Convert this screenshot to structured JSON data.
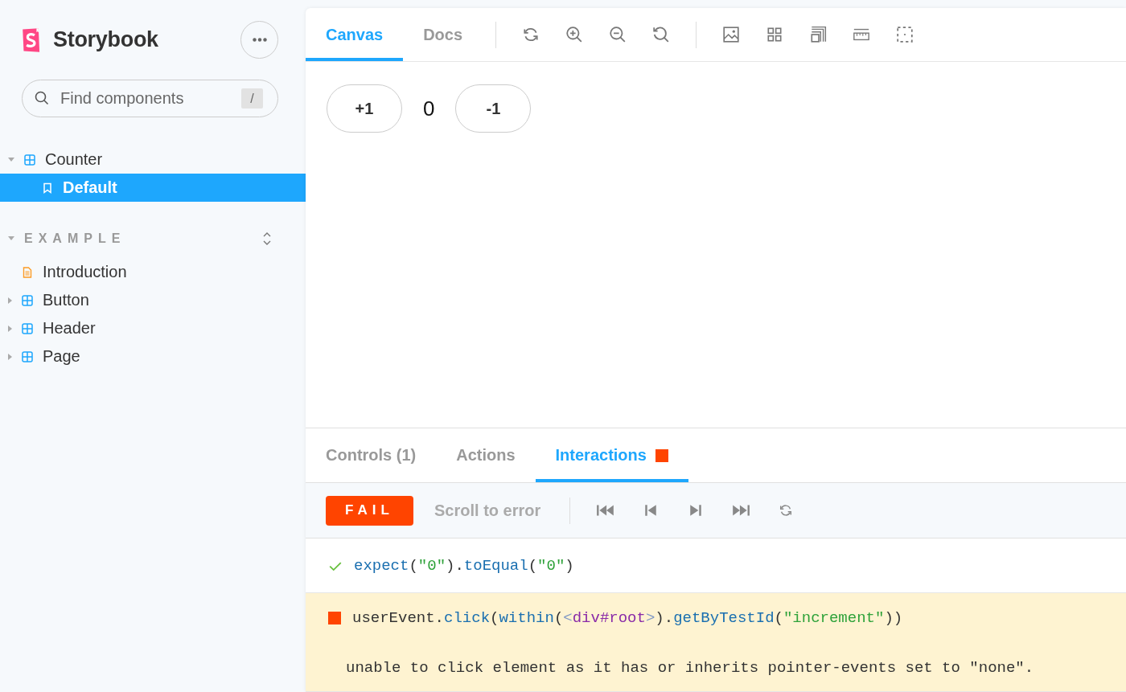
{
  "sidebar": {
    "brand": "Storybook",
    "search": {
      "placeholder": "Find components",
      "shortcut": "/"
    },
    "tree": [
      {
        "label": "Counter",
        "kind": "component",
        "expanded": true,
        "selected": false,
        "children": [
          {
            "label": "Default",
            "kind": "story",
            "selected": true
          }
        ]
      }
    ],
    "groups": [
      {
        "title": "EXAMPLE",
        "expanded": true,
        "items": [
          {
            "label": "Introduction",
            "kind": "doc",
            "expanded": false,
            "selected": false
          },
          {
            "label": "Button",
            "kind": "component",
            "expanded": false,
            "selected": false
          },
          {
            "label": "Header",
            "kind": "component",
            "expanded": false,
            "selected": false
          },
          {
            "label": "Page",
            "kind": "component",
            "expanded": false,
            "selected": false
          }
        ]
      }
    ]
  },
  "toolbar": {
    "tabs": [
      {
        "label": "Canvas",
        "selected": true
      },
      {
        "label": "Docs",
        "selected": false
      }
    ]
  },
  "preview": {
    "increment": "+1",
    "count": "0",
    "decrement": "-1"
  },
  "addons": {
    "tabs": [
      {
        "label": "Controls (1)",
        "selected": false,
        "alert": false
      },
      {
        "label": "Actions",
        "selected": false,
        "alert": false
      },
      {
        "label": "Interactions",
        "selected": true,
        "alert": true
      }
    ],
    "status": {
      "label": "FAIL",
      "kind": "fail"
    },
    "scroll_link": "Scroll to error",
    "steps": [
      {
        "kind": "pass",
        "tokens": [
          {
            "text": "expect",
            "kind": "fn"
          },
          {
            "text": "(",
            "kind": "plain"
          },
          {
            "text": "\"0\"",
            "kind": "string"
          },
          {
            "text": ").",
            "kind": "plain"
          },
          {
            "text": "toEqual",
            "kind": "fn"
          },
          {
            "text": "(",
            "kind": "plain"
          },
          {
            "text": "\"0\"",
            "kind": "string"
          },
          {
            "text": ")",
            "kind": "plain"
          }
        ]
      },
      {
        "kind": "fail",
        "tokens": [
          {
            "text": "userEvent.",
            "kind": "plain"
          },
          {
            "text": "click",
            "kind": "fn"
          },
          {
            "text": "(",
            "kind": "plain"
          },
          {
            "text": "within",
            "kind": "fn"
          },
          {
            "text": "(",
            "kind": "plain"
          },
          {
            "text": "<",
            "kind": "punct"
          },
          {
            "text": "div#root",
            "kind": "tag"
          },
          {
            "text": ">",
            "kind": "punct"
          },
          {
            "text": ").",
            "kind": "plain"
          },
          {
            "text": "getByTestId",
            "kind": "fn"
          },
          {
            "text": "(",
            "kind": "plain"
          },
          {
            "text": "\"increment\"",
            "kind": "string"
          },
          {
            "text": "))",
            "kind": "plain"
          }
        ],
        "message": "unable to click element as it has or inherits pointer-events set to \"none\"."
      }
    ]
  }
}
